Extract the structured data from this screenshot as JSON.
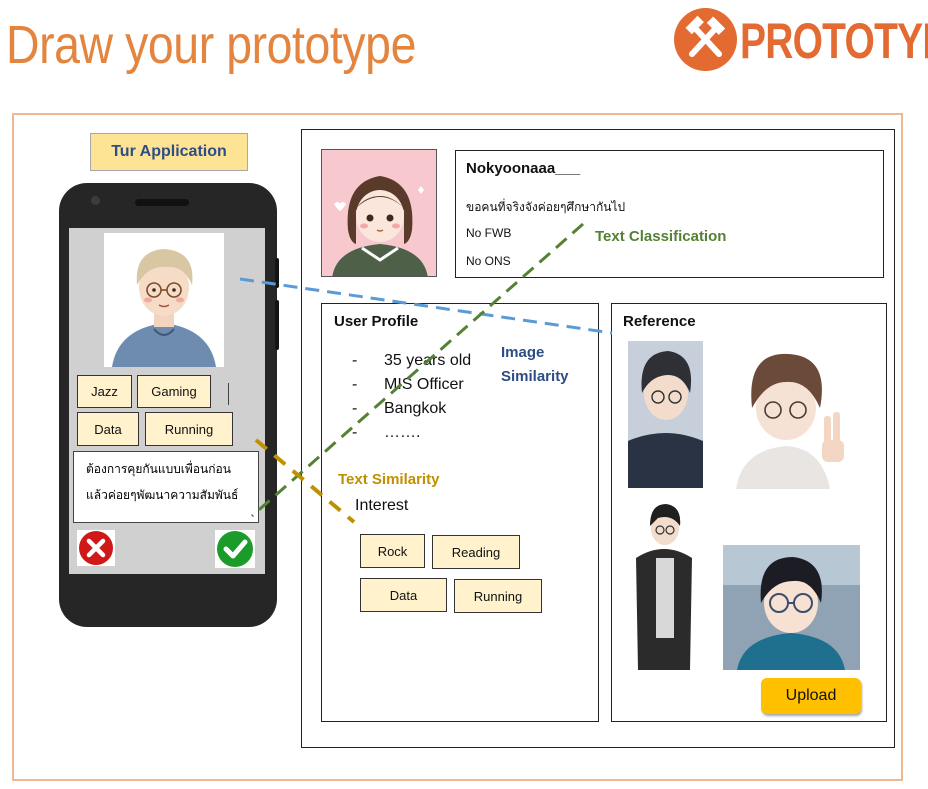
{
  "page": {
    "title": "Draw your prototype",
    "logo_text": "PROTOTYPE",
    "logo_icon": "crossed-hammers-icon"
  },
  "app": {
    "title": "Tur Application",
    "avatar_alt": "boy-with-glasses-avatar",
    "tags": [
      "Jazz",
      "Gaming",
      "Data",
      "Running"
    ],
    "note_lines": [
      "ต้องการคุยกันแบบเพื่อนก่อน",
      "แล้วค่อยๆพัฒนาความสัมพันธ์"
    ],
    "reject_icon": "red-x-icon",
    "accept_icon": "green-check-icon"
  },
  "profile_card": {
    "username": "Nokyoonaaa___",
    "bio": "ขอคนที่จริงจังค่อยๆศึกษากันไป",
    "line1": "No FWB",
    "line2": "No ONS"
  },
  "user_profile": {
    "header": "User Profile",
    "items": [
      "35 years old",
      "MIS Officer",
      "Bangkok",
      "……."
    ],
    "interest_label": "Interest",
    "interests": [
      "Rock",
      "Reading",
      "Data",
      "Running"
    ]
  },
  "reference": {
    "header": "Reference",
    "upload_label": "Upload"
  },
  "annotations": {
    "image_similarity_1": "Image",
    "image_similarity_2": "Similarity",
    "text_classification": "Text Classification",
    "text_similarity": "Text Similarity"
  },
  "colors": {
    "title": "#e4853f",
    "logo": "#e36a31",
    "image_similarity": "#5b9bd5",
    "text_classification": "#548235",
    "text_similarity": "#bf9000",
    "tag_fill": "#fff2cc",
    "upload": "#ffc000"
  }
}
